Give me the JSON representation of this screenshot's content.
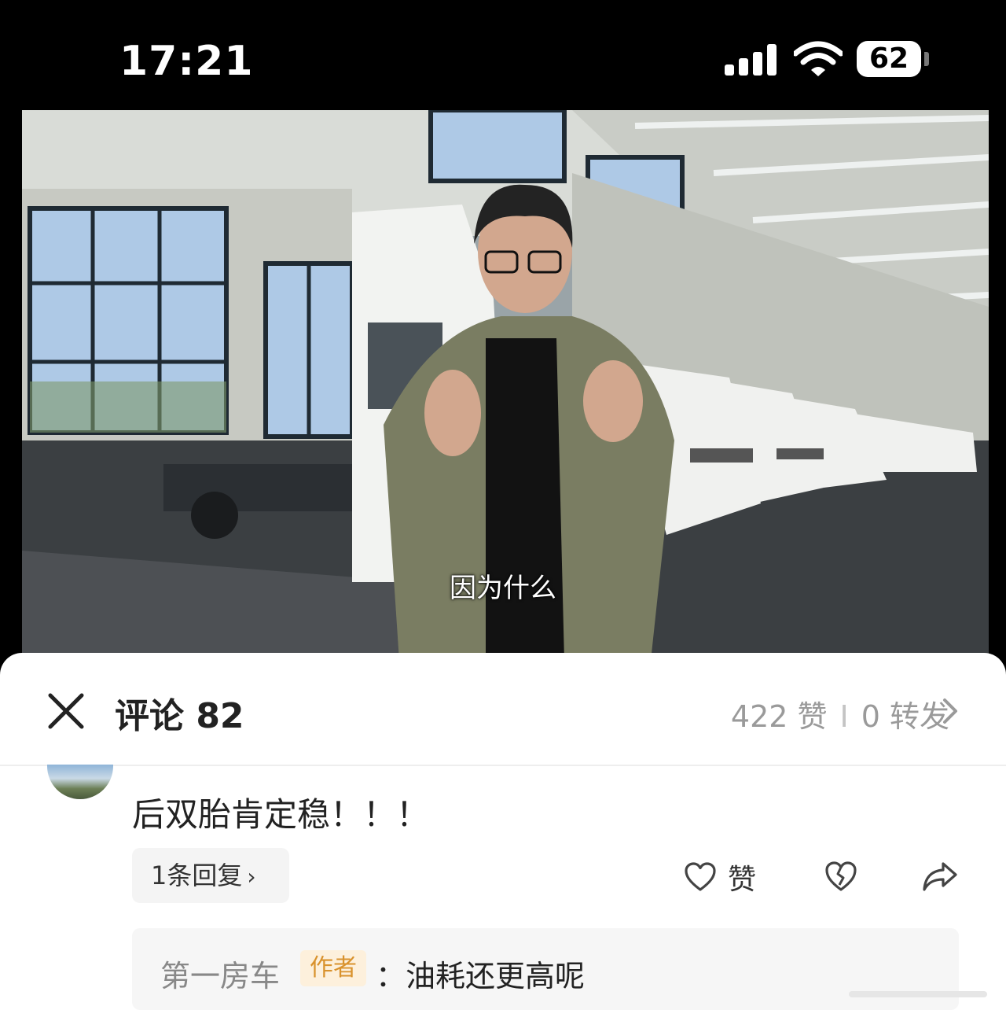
{
  "status_bar": {
    "time": "17:21",
    "battery": "62"
  },
  "video": {
    "subtitle": "因为什么"
  },
  "comments_panel": {
    "title": "评论 82",
    "likes": "422 赞",
    "separator": "I",
    "shares": "0 转发"
  },
  "comment": {
    "text": "后双胎肯定稳！！！",
    "replies_label": "1条回复",
    "like_label": "赞",
    "reply_preview": {
      "author": "第一房车",
      "badge": "作者",
      "text": "：油耗还更高呢"
    }
  }
}
